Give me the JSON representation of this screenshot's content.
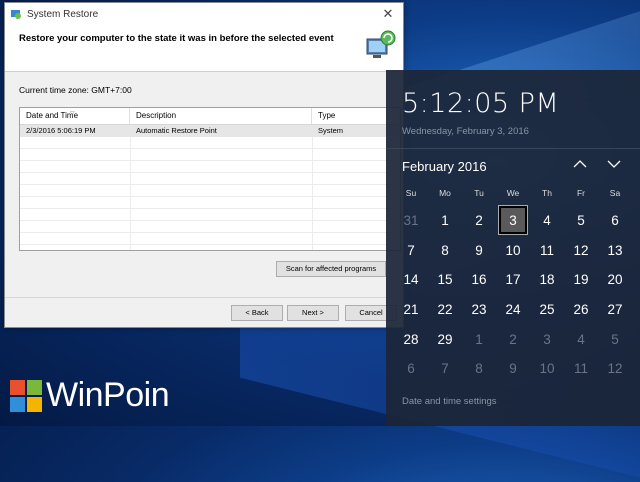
{
  "dialog": {
    "title": "System Restore",
    "heading": "Restore your computer to the state it was in before the selected event",
    "timezone": "Current time zone: GMT+7:00",
    "columns": [
      "Date and Time",
      "Description",
      "Type"
    ],
    "rows": [
      {
        "date": "2/3/2016 5:06:19 PM",
        "description": "Automatic Restore Point",
        "type": "System"
      }
    ],
    "scan_button": "Scan for affected programs",
    "back_button": "< Back",
    "next_button": "Next >",
    "cancel_button": "Cancel"
  },
  "calendar": {
    "time": "5:12:05 PM",
    "date": "Wednesday, February 3, 2016",
    "month": "February 2016",
    "weekdays": [
      "Su",
      "Mo",
      "Tu",
      "We",
      "Th",
      "Fr",
      "Sa"
    ],
    "days": [
      {
        "n": "31",
        "dim": true
      },
      {
        "n": "1"
      },
      {
        "n": "2"
      },
      {
        "n": "3",
        "today": true
      },
      {
        "n": "4"
      },
      {
        "n": "5"
      },
      {
        "n": "6"
      },
      {
        "n": "7"
      },
      {
        "n": "8"
      },
      {
        "n": "9"
      },
      {
        "n": "10"
      },
      {
        "n": "11"
      },
      {
        "n": "12"
      },
      {
        "n": "13"
      },
      {
        "n": "14"
      },
      {
        "n": "15"
      },
      {
        "n": "16"
      },
      {
        "n": "17"
      },
      {
        "n": "18"
      },
      {
        "n": "19"
      },
      {
        "n": "20"
      },
      {
        "n": "21"
      },
      {
        "n": "22"
      },
      {
        "n": "23"
      },
      {
        "n": "24"
      },
      {
        "n": "25"
      },
      {
        "n": "26"
      },
      {
        "n": "27"
      },
      {
        "n": "28"
      },
      {
        "n": "29"
      },
      {
        "n": "1",
        "dim": true
      },
      {
        "n": "2",
        "dim": true
      },
      {
        "n": "3",
        "dim": true
      },
      {
        "n": "4",
        "dim": true
      },
      {
        "n": "5",
        "dim": true
      },
      {
        "n": "6",
        "dim": true
      },
      {
        "n": "7",
        "dim": true
      },
      {
        "n": "8",
        "dim": true
      },
      {
        "n": "9",
        "dim": true
      },
      {
        "n": "10",
        "dim": true
      },
      {
        "n": "11",
        "dim": true
      },
      {
        "n": "12",
        "dim": true
      }
    ],
    "settings_link": "Date and time settings"
  },
  "watermark": {
    "text": "WinPoin"
  },
  "colors": {
    "flyout_bg": "#1c2638",
    "dim_text": "#8a94a5",
    "today_fill": "#5a5a5a",
    "wallpaper": "#0d3d88"
  }
}
